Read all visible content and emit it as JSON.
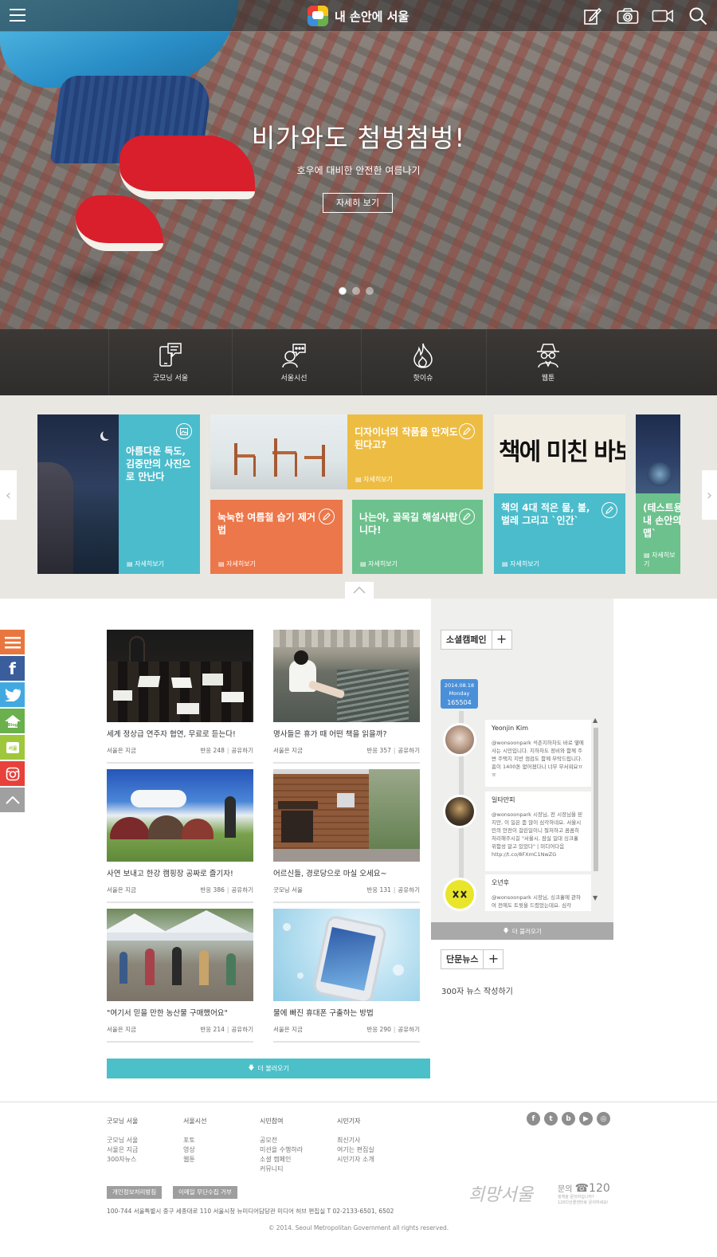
{
  "header": {
    "brand": "내 손안에 서울",
    "icons": [
      "menu-icon",
      "write-icon",
      "camera-icon",
      "video-icon",
      "search-icon"
    ]
  },
  "hero": {
    "title": "비가와도 첨벙첨벙!",
    "subtitle": "호우에 대비한 안전한 여름나기",
    "button": "자세히 보기",
    "slides": 3,
    "active_slide": 1
  },
  "quicknav": [
    {
      "label": "굿모닝 서울",
      "icon": "phone-chat-icon"
    },
    {
      "label": "서울시선",
      "icon": "speech-person-icon"
    },
    {
      "label": "핫이슈",
      "icon": "fire-icon"
    },
    {
      "label": "웹툰",
      "icon": "spy-icon"
    }
  ],
  "carousel": {
    "more_label": "자세히보기",
    "tiles": [
      {
        "title": "아름다운 독도, 김중만의 사진으로 만난다",
        "color": "#4bbccb"
      },
      {
        "title": "디자이너의 작품을 만져도 된다고?",
        "color": "#edbd43"
      },
      {
        "title": "눅눅한 여름철 습기 제거법",
        "color": "#ec774a"
      },
      {
        "title": "나는야, 골목길 해설사랍니다!",
        "color": "#6cc18c"
      },
      {
        "title": "책의 4대 적은 물, 불, 벌레 그리고 `인간`",
        "color": "#4bbccb"
      },
      {
        "title": "(테스트용) 내 손안의 홀맵`",
        "color": "#6cc18c"
      }
    ],
    "calligraphy": "책에 미친 바보"
  },
  "side_social": [
    {
      "name": "menu",
      "color": "#e8773f",
      "glyph": "≡"
    },
    {
      "name": "facebook",
      "color": "#3a5d9c",
      "glyph": "f"
    },
    {
      "name": "twitter",
      "color": "#42a9e0",
      "glyph": "t"
    },
    {
      "name": "blog",
      "color": "#6ab04c",
      "glyph": "Blog"
    },
    {
      "name": "seoul",
      "color": "#9fc73b",
      "glyph": "S"
    },
    {
      "name": "instagram",
      "color": "#e8403a",
      "glyph": "◉"
    },
    {
      "name": "top",
      "color": "#a0a0a0",
      "glyph": "︿"
    }
  ],
  "articles": [
    {
      "title": "세계 정상급 연주자 협연, 무료로 듣는다!",
      "source": "서울은 지금",
      "reactions": "반응 248",
      "share": "공유하기"
    },
    {
      "title": "명사들은 휴가 때 어떤 책을 읽을까?",
      "source": "서울은 지금",
      "reactions": "반응 357",
      "share": "공유하기"
    },
    {
      "title": "사연 보내고 한강 캠핑장 공짜로 즐기자!",
      "source": "서울은 지금",
      "reactions": "반응 386",
      "share": "공유하기"
    },
    {
      "title": "어르신들, 경로당으로 마실 오세요~",
      "source": "굿모닝 서울",
      "reactions": "반응 131",
      "share": "공유하기"
    },
    {
      "title": "\"여기서 믿을 만한 농산물 구매했어요\"",
      "source": "서울은 지금",
      "reactions": "반응 214",
      "share": "공유하기"
    },
    {
      "title": "물에 빠진 휴대폰 구출하는 방법",
      "source": "서울은 지금",
      "reactions": "반응 290",
      "share": "공유하기"
    }
  ],
  "load_more": "더 불러오기",
  "social_campaign": {
    "title": "소셜캠페인",
    "plus": "+",
    "date_line1": "2014.08.18",
    "date_line2": "Monday",
    "date_line3": "165504",
    "tweets": [
      {
        "user": "Yeonjin Kim",
        "text": "@wonsoonpark 석촌지하차도 바로 옆에 사는 시민입니다. 지하차도 정비와 함께 주변 주택지 지반 점검도 함께 부탁드립니다. 흠이 1400톤 없어졌다니 너무 무서워요ㅠㅠ"
      },
      {
        "user": "일타만피",
        "text": "@wonsoonpark 시장님, 전 시장님을 믿지만, 이 일은 좀 많이 심각하네요. 서울시민의 안전이 걸린일이니 절저하고 꼼꼼히 처리해주시길 \"서울시, 잠실 일대 싱크홀 위험성 알고 있었다\" | 미디어다음 http://t.co/8FXmC1NwZG"
      },
      {
        "user": "오년후",
        "text": "@wonsoonpark 시장님, 싱크홀에 관하여 전에도 트윗을 드렸었는데요. 심각"
      }
    ],
    "more": "더 불러오기"
  },
  "short_news": {
    "title": "단문뉴스",
    "plus": "+",
    "write": "300자 뉴스 작성하기"
  },
  "footer": {
    "columns": [
      {
        "head": "굿모닝 서울",
        "items": [
          "굿모닝 서울",
          "서울은 지금",
          "300자뉴스"
        ]
      },
      {
        "head": "서울시선",
        "items": [
          "포토",
          "영상",
          "웹툰"
        ]
      },
      {
        "head": "시민참여",
        "items": [
          "공모전",
          "미션을 수행하라",
          "소셜 캠페인",
          "커뮤니티"
        ]
      },
      {
        "head": "시민기자",
        "items": [
          "최신기사",
          "여기는 편집실",
          "시민기자 소개"
        ]
      }
    ],
    "social": [
      "f",
      "t",
      "b",
      "▶",
      "◎"
    ],
    "privacy": "개인정보처리방침",
    "email_refusal": "이메일 무단수집 거부",
    "address": "100-744 서울특별시 중구 세종대로 110 서울시청 뉴미디어담당관 미디어 허브 편집실 T 02-2133-6501, 6502",
    "copyright": "© 2014. Seoul Metropolitan Government all rights reserved.",
    "hope_logo": "희망서울",
    "inquiry_label": "문의",
    "inquiry_number": "☎120",
    "inquiry_note1": "정책을 문의하십니까?",
    "inquiry_note2": "120다산콜센터로 문의하세요!"
  }
}
